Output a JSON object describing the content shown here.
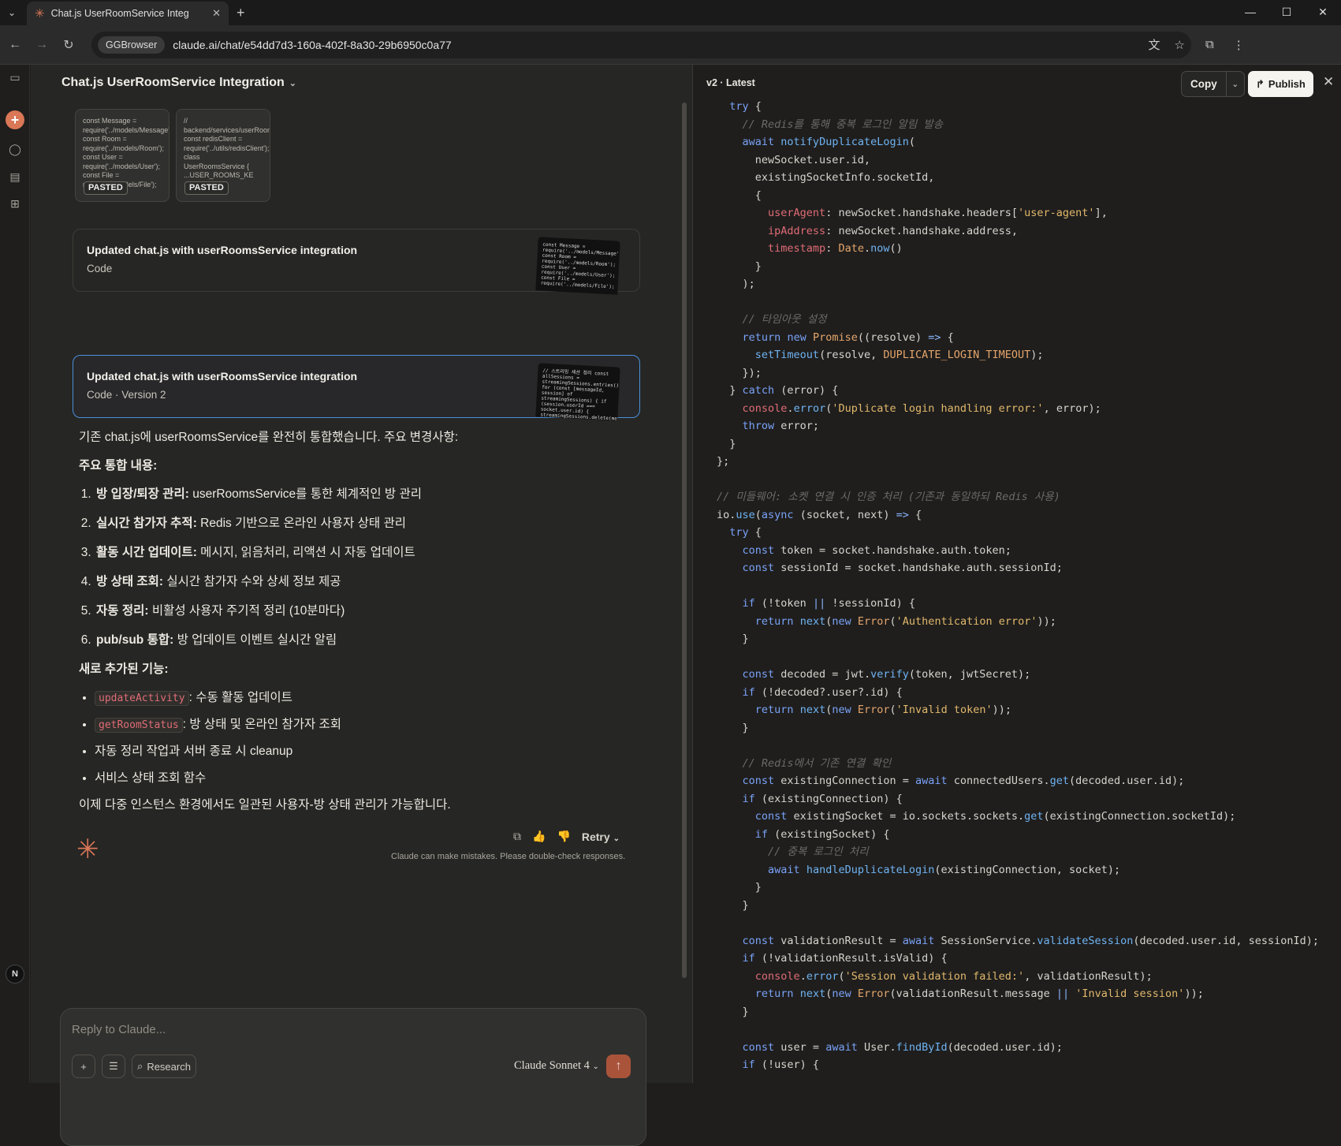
{
  "browser": {
    "tab_title": "Chat.js UserRoomService Integ",
    "site_chip": "GGBrowser",
    "url": "claude.ai/chat/e54dd7d3-160a-402f-8a30-29b6950c0a77"
  },
  "chat": {
    "title": "Chat.js UserRoomService Integration",
    "pasted": [
      {
        "preview": "const Message = require('../models/Message'); const Room = require('../models/Room'); const User = require('../models/User'); const File = require('../models/File');",
        "badge": "PASTED"
      },
      {
        "preview": "// backend/services/userRoomsService.js const redisClient = require('../utils/redisClient'); class UserRoomsService { ...USER_ROOMS_KE",
        "badge": "PASTED"
      }
    ],
    "artifacts": [
      {
        "title": "Updated chat.js with userRoomsService integration",
        "subtitle": "Code",
        "thumb": "const Message = require('../models/Message'); const Room = require('../models/Room'); const User = require('../models/User'); const File = require('../models/File');"
      },
      {
        "title": "Updated chat.js with userRoomsService integration",
        "subtitle": "Code · Version 2",
        "thumb": "// 스트리밍 세션 정리 const allSessions = streamingSessions.entries(); for (const [messageId, session] of streamingSessions) { if (session.userId === socket.user.id) { streamingSessions.delete(messageId);"
      }
    ],
    "message": {
      "intro": "기존 chat.js에 userRoomsService를 완전히 통합했습니다. 주요 변경사항:",
      "heading1": "주요 통합 내용:",
      "ordered": [
        {
          "bold": "방 입장/퇴장 관리:",
          "text": " userRoomsService를 통한 체계적인 방 관리"
        },
        {
          "bold": "실시간 참가자 추적:",
          "text": " Redis 기반으로 온라인 사용자 상태 관리"
        },
        {
          "bold": "활동 시간 업데이트:",
          "text": " 메시지, 읽음처리, 리액션 시 자동 업데이트"
        },
        {
          "bold": "방 상태 조회:",
          "text": " 실시간 참가자 수와 상세 정보 제공"
        },
        {
          "bold": "자동 정리:",
          "text": " 비활성 사용자 주기적 정리 (10분마다)"
        },
        {
          "bold": "pub/sub 통합:",
          "text": " 방 업데이트 이벤트 실시간 알림"
        }
      ],
      "heading2": "새로 추가된 기능:",
      "bullets": [
        {
          "code": "updateActivity",
          "text": ": 수동 활동 업데이트"
        },
        {
          "code": "getRoomStatus",
          "text": ": 방 상태 및 온라인 참가자 조회"
        },
        {
          "code": "",
          "text": "자동 정리 작업과 서버 종료 시 cleanup"
        },
        {
          "code": "",
          "text": "서비스 상태 조회 함수"
        }
      ],
      "outro": "이제 다중 인스턴스 환경에서도 일관된 사용자-방 상태 관리가 가능합니다."
    },
    "retry_label": "Retry",
    "disclaimer": "Claude can make mistakes. Please double-check responses.",
    "composer": {
      "placeholder": "Reply to Claude...",
      "research_label": "Research",
      "model": "Claude Sonnet 4"
    },
    "user_initial": "N"
  },
  "panel": {
    "version": "v2 · Latest",
    "copy_label": "Copy",
    "publish_label": "Publish",
    "code_lines": [
      "  try {",
      "    // Redis를 통해 중복 로그인 알림 발송",
      "    await notifyDuplicateLogin(",
      "      newSocket.user.id,",
      "      existingSocketInfo.socketId,",
      "      {",
      "        userAgent: newSocket.handshake.headers['user-agent'],",
      "        ipAddress: newSocket.handshake.address,",
      "        timestamp: Date.now()",
      "      }",
      "    );",
      "",
      "    // 타임아웃 설정",
      "    return new Promise((resolve) => {",
      "      setTimeout(resolve, DUPLICATE_LOGIN_TIMEOUT);",
      "    });",
      "  } catch (error) {",
      "    console.error('Duplicate login handling error:', error);",
      "    throw error;",
      "  }",
      "};",
      "",
      "// 미들웨어: 소켓 연결 시 인증 처리 (기존과 동일하되 Redis 사용)",
      "io.use(async (socket, next) => {",
      "  try {",
      "    const token = socket.handshake.auth.token;",
      "    const sessionId = socket.handshake.auth.sessionId;",
      "",
      "    if (!token || !sessionId) {",
      "      return next(new Error('Authentication error'));",
      "    }",
      "",
      "    const decoded = jwt.verify(token, jwtSecret);",
      "    if (!decoded?.user?.id) {",
      "      return next(new Error('Invalid token'));",
      "    }",
      "",
      "    // Redis에서 기존 연결 확인",
      "    const existingConnection = await connectedUsers.get(decoded.user.id);",
      "    if (existingConnection) {",
      "      const existingSocket = io.sockets.sockets.get(existingConnection.socketId);",
      "      if (existingSocket) {",
      "        // 중복 로그인 처리",
      "        await handleDuplicateLogin(existingConnection, socket);",
      "      }",
      "    }",
      "",
      "    const validationResult = await SessionService.validateSession(decoded.user.id, sessionId);",
      "    if (!validationResult.isValid) {",
      "      console.error('Session validation failed:', validationResult);",
      "      return next(new Error(validationResult.message || 'Invalid session'));",
      "    }",
      "",
      "    const user = await User.findById(decoded.user.id);",
      "    if (!user) {"
    ]
  }
}
